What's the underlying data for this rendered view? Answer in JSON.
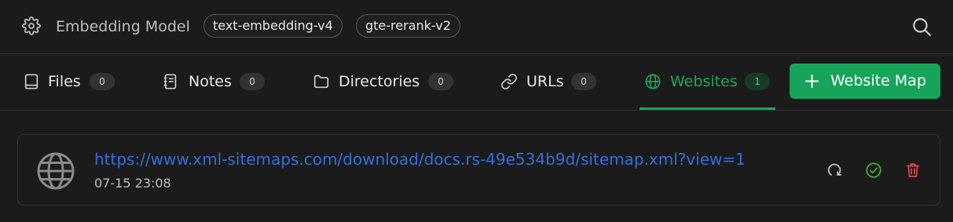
{
  "header": {
    "model_label": "Embedding Model",
    "chips": [
      "text-embedding-v4",
      "gte-rerank-v2"
    ]
  },
  "tabs": [
    {
      "label": "Files",
      "count": "0",
      "icon": "file-icon",
      "active": false
    },
    {
      "label": "Notes",
      "count": "0",
      "icon": "notebook-icon",
      "active": false
    },
    {
      "label": "Directories",
      "count": "0",
      "icon": "folder-icon",
      "active": false
    },
    {
      "label": "URLs",
      "count": "0",
      "icon": "link-icon",
      "active": false
    },
    {
      "label": "Websites",
      "count": "1",
      "icon": "globe-icon",
      "active": true
    }
  ],
  "add_button": {
    "label": "Website Map"
  },
  "items": [
    {
      "url": "https://www.xml-sitemaps.com/download/docs.rs-49e534b9d/sitemap.xml?view=1",
      "time": "07-15 23:08"
    }
  ],
  "colors": {
    "accent": "#16a35a",
    "link": "#2f6fe0",
    "background": "#1b1b1b",
    "success": "#3fbf3f",
    "danger": "#e5484d"
  }
}
